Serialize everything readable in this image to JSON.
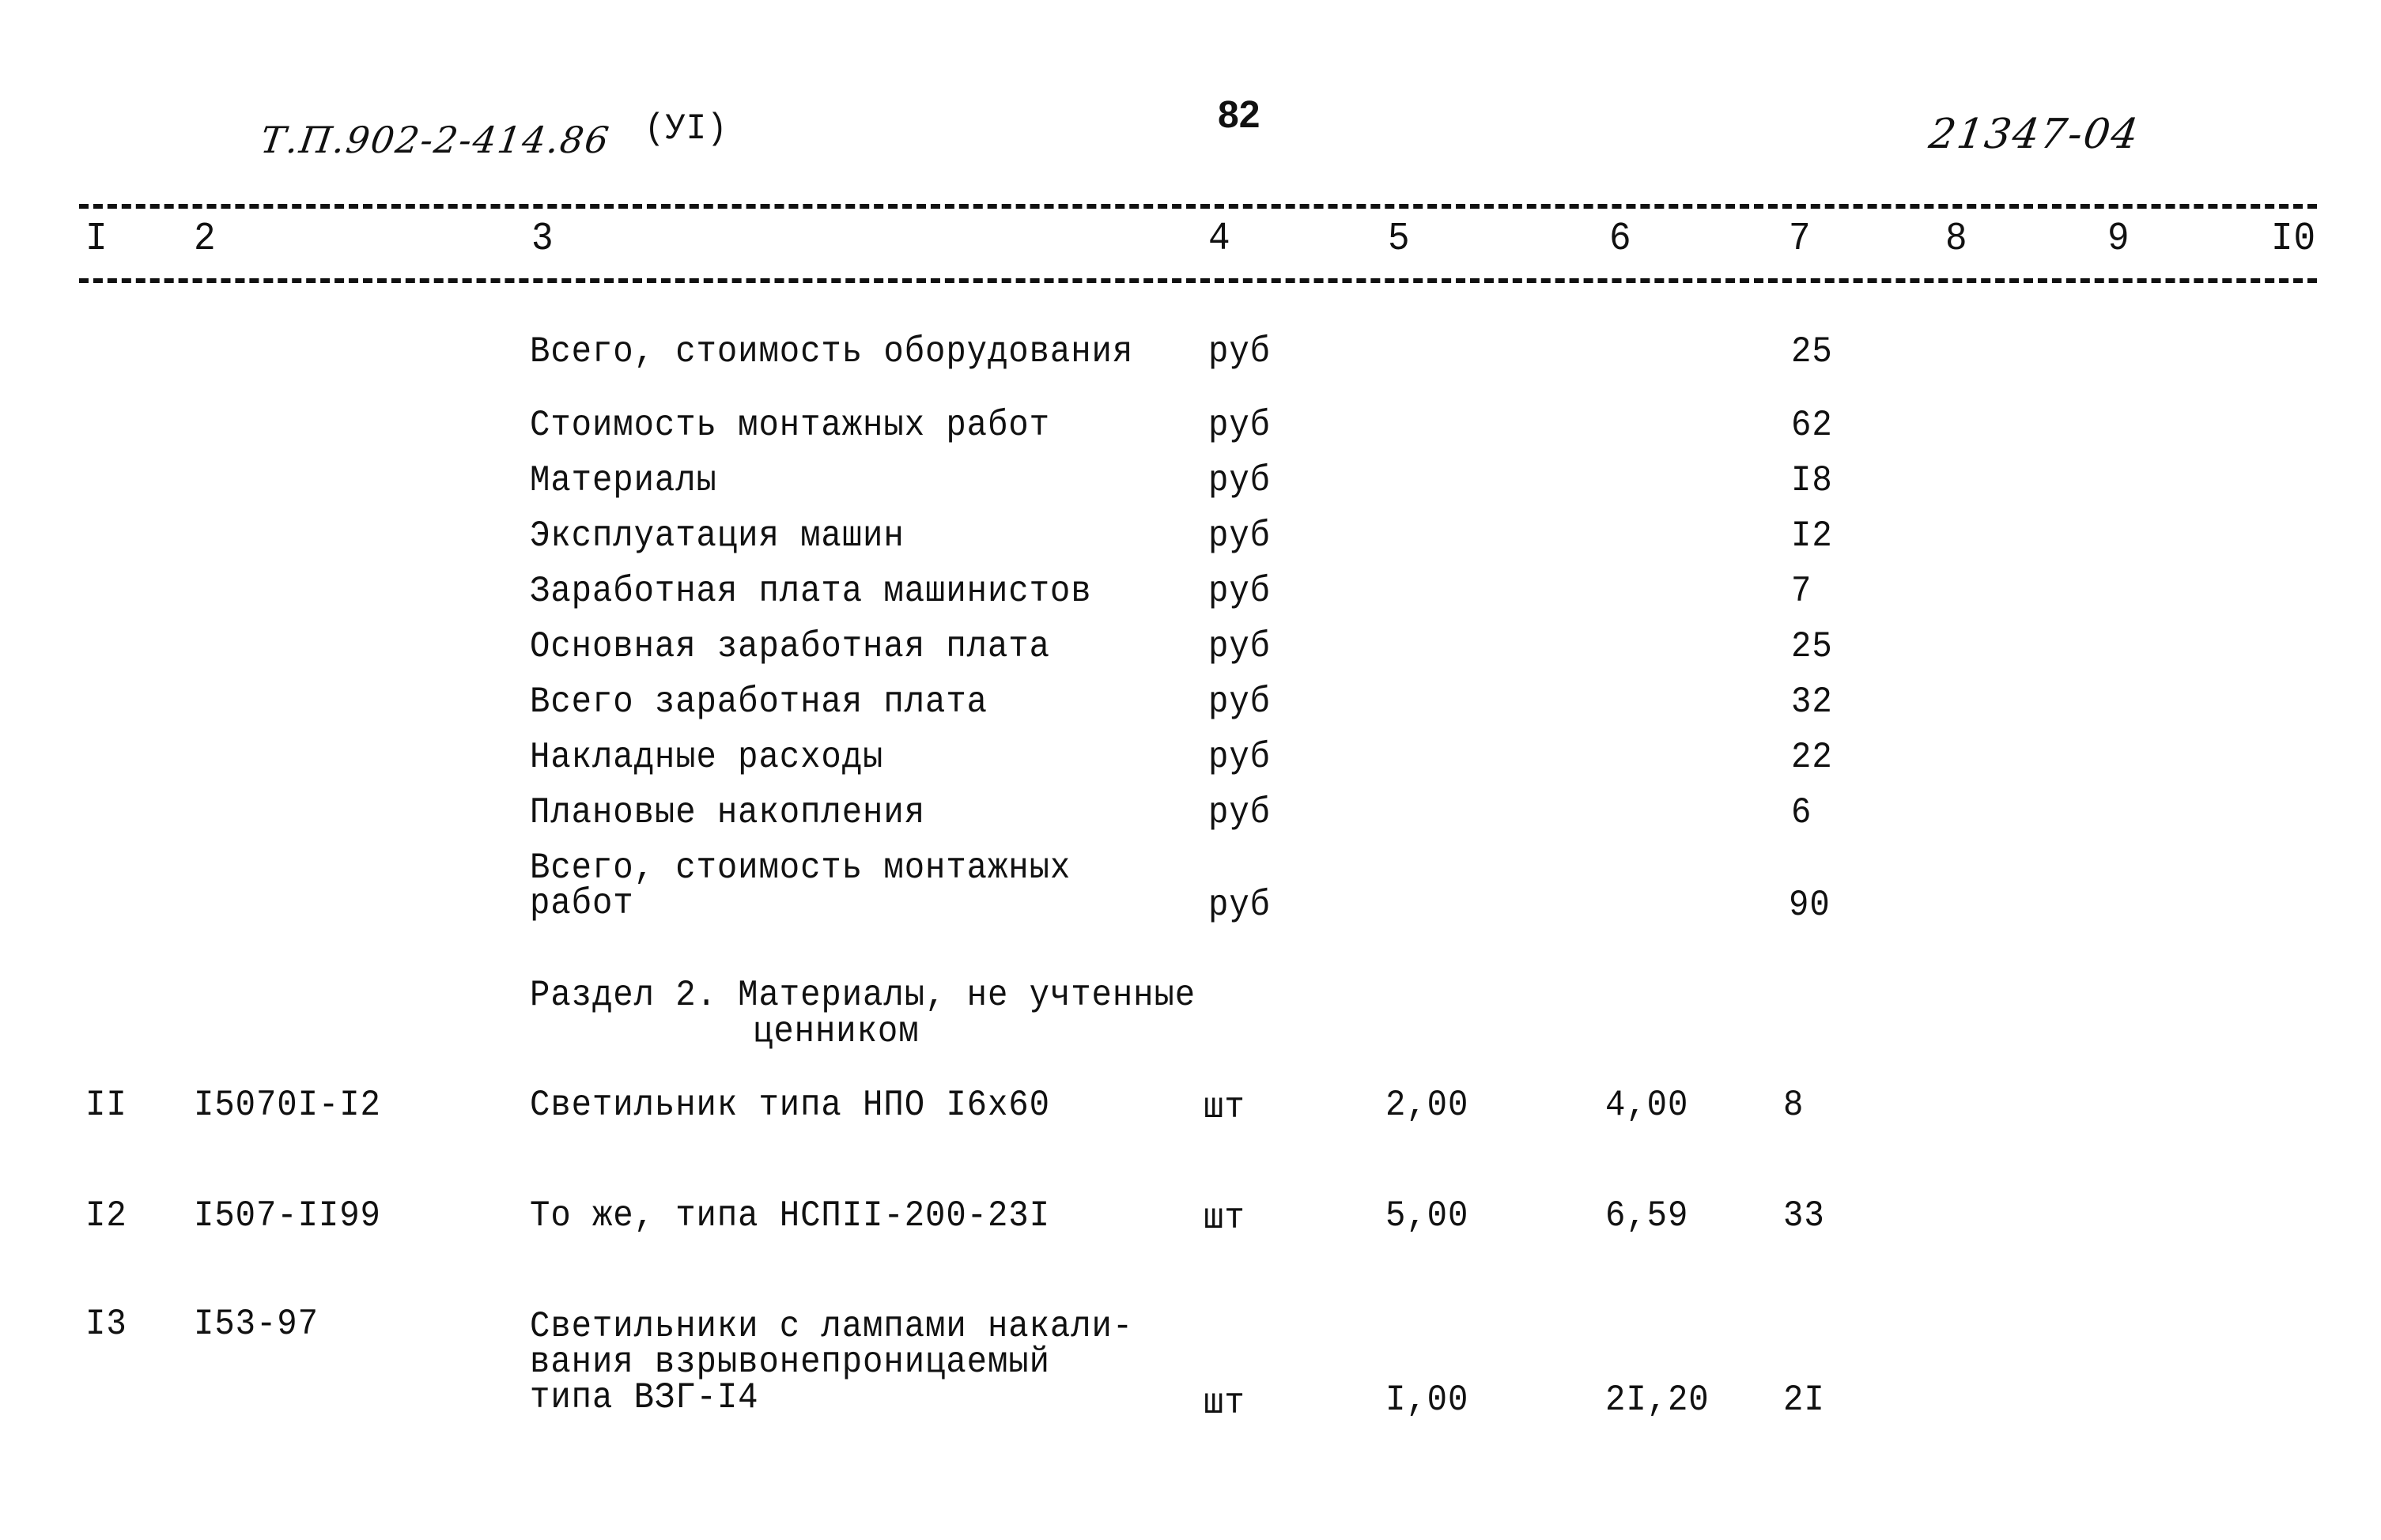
{
  "header": {
    "doc_code": "Т.П.902-2-414.86",
    "volume": "(УI)",
    "page_number": "82",
    "inventory_number": "21347-04"
  },
  "columns": [
    "I",
    "2",
    "3",
    "4",
    "5",
    "6",
    "7",
    "8",
    "9",
    "I0"
  ],
  "summary_rows": [
    {
      "name": "Всего, стоимость оборудования",
      "unit": "руб",
      "total": "25"
    },
    {
      "name": "Стоимость монтажных работ",
      "unit": "руб",
      "total": "62"
    },
    {
      "name": "Материалы",
      "unit": "руб",
      "total": "I8"
    },
    {
      "name": "Эксплуатация машин",
      "unit": "руб",
      "total": "I2"
    },
    {
      "name": "Заработная плата машинистов",
      "unit": "руб",
      "total": "7"
    },
    {
      "name": "Основная заработная плата",
      "unit": "руб",
      "total": "25"
    },
    {
      "name": "Всего заработная плата",
      "unit": "руб",
      "total": "32"
    },
    {
      "name": "Накладные расходы",
      "unit": "руб",
      "total": "22"
    },
    {
      "name": "Плановые накопления",
      "unit": "руб",
      "total": "6"
    },
    {
      "name_line1": "Всего, стоимость монтажных",
      "name_line2": "работ",
      "unit": "руб",
      "total": "90"
    }
  ],
  "section": {
    "line1": "Раздел 2. Материалы, не учтенные",
    "line2": "ценником"
  },
  "items": [
    {
      "num": "II",
      "code": "I5070I-I2",
      "name_lines": [
        "Светильник типа НПО I6х60"
      ],
      "unit": "шт",
      "qty": "2,00",
      "price": "4,00",
      "total": "8"
    },
    {
      "num": "I2",
      "code": "I507-II99",
      "name_lines": [
        "То же, типа НСПII-200-23I"
      ],
      "unit": "шт",
      "qty": "5,00",
      "price": "6,59",
      "total": "33"
    },
    {
      "num": "I3",
      "code": "I53-97",
      "name_lines": [
        "Светильники с лампами накали-",
        "вания взрывонепроницаемый",
        "типа ВЗГ-I4"
      ],
      "unit": "шт",
      "qty": "I,00",
      "price": "2I,20",
      "total": "2I"
    }
  ]
}
